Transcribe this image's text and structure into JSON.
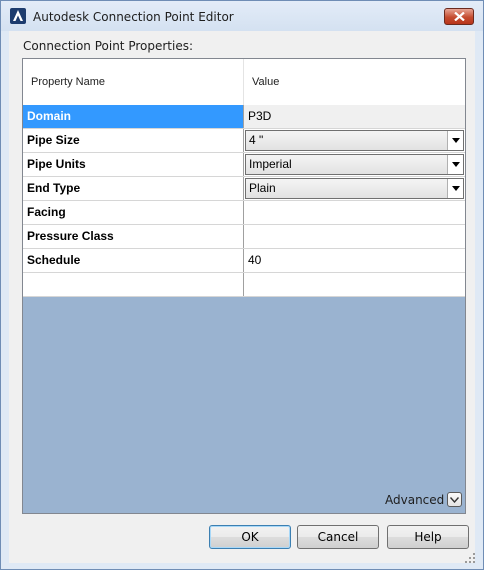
{
  "window": {
    "title": "Autodesk Connection Point Editor"
  },
  "section": {
    "label": "Connection Point Properties:"
  },
  "grid": {
    "headers": {
      "name": "Property Name",
      "value": "Value"
    },
    "rows": [
      {
        "name": "Domain",
        "value": "P3D",
        "kind": "readonly",
        "selected": true
      },
      {
        "name": "Pipe Size",
        "value": "4 \"",
        "kind": "combo"
      },
      {
        "name": "Pipe Units",
        "value": "Imperial",
        "kind": "combo"
      },
      {
        "name": "End Type",
        "value": "Plain",
        "kind": "combo"
      },
      {
        "name": "Facing",
        "value": "",
        "kind": "text"
      },
      {
        "name": "Pressure Class",
        "value": "",
        "kind": "text"
      },
      {
        "name": "Schedule",
        "value": "40",
        "kind": "text"
      },
      {
        "name": "",
        "value": "",
        "kind": "text"
      }
    ]
  },
  "footer": {
    "advanced_label": "Advanced",
    "ok_label": "OK",
    "cancel_label": "Cancel",
    "help_label": "Help"
  },
  "icons": {
    "app": "autocad-app-icon",
    "close": "close-icon",
    "dropdown": "chevron-down-icon",
    "advanced": "chevron-down-icon",
    "grip": "resize-grip-icon"
  },
  "colors": {
    "selection": "#3399ff",
    "empty_grid_area": "#9ab3d0",
    "close_button": "#c54c30"
  }
}
